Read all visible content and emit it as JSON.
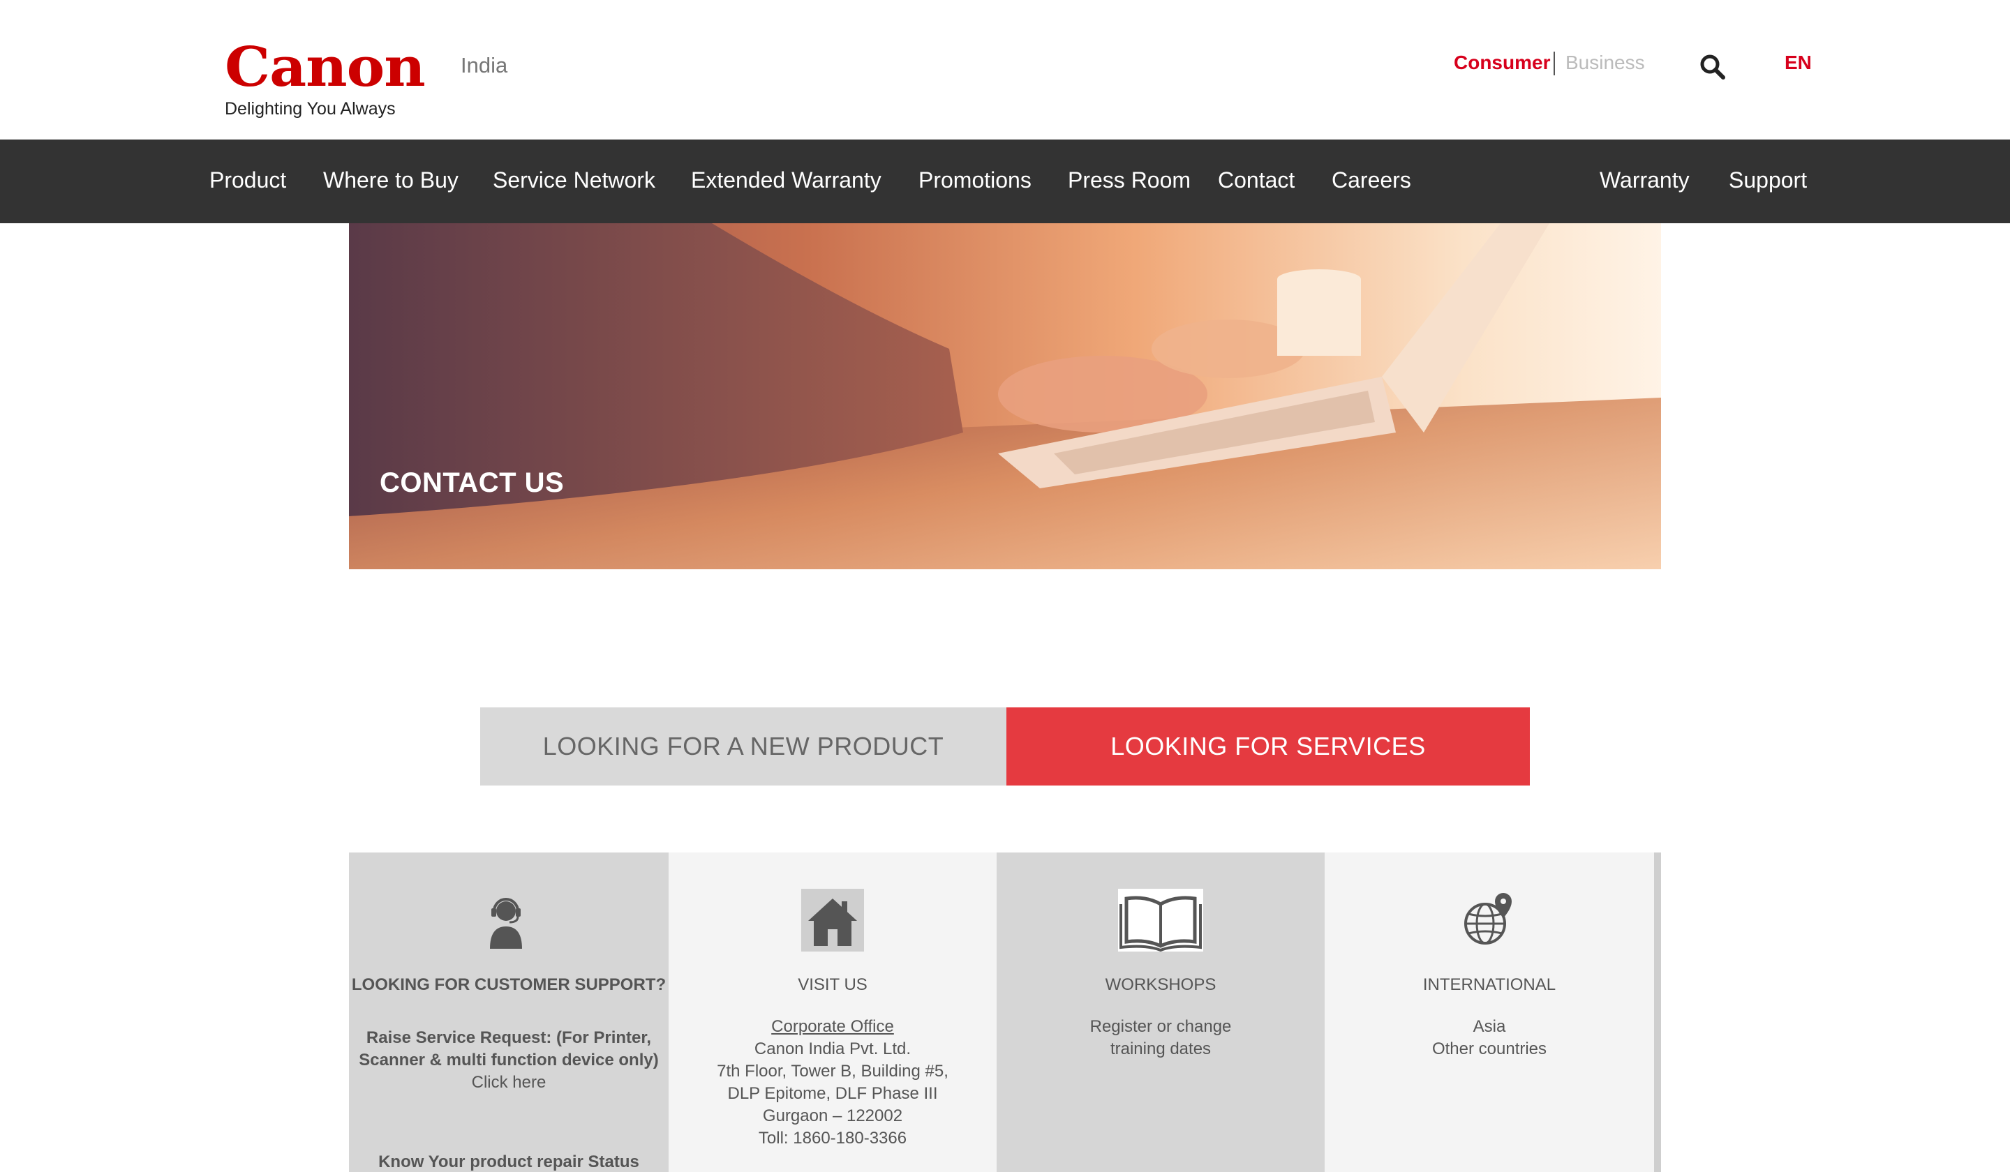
{
  "header": {
    "brand": "Canon",
    "tagline": "Delighting You Always",
    "region": "India",
    "segment_consumer": "Consumer",
    "segment_business": "Business",
    "language": "EN"
  },
  "nav": {
    "items": [
      "Product",
      "Where to Buy",
      "Service Network",
      "Extended Warranty",
      "Promotions",
      "Press Room",
      "Contact",
      "Careers"
    ],
    "right_items": [
      "Warranty",
      "Support"
    ]
  },
  "hero": {
    "title": "CONTACT US"
  },
  "tabs": {
    "new_product": "LOOKING FOR A NEW PRODUCT",
    "services": "LOOKING FOR SERVICES"
  },
  "cards": {
    "support": {
      "icon": "headset-user-icon",
      "title": "LOOKING FOR CUSTOMER SUPPORT?",
      "line1": "Raise Service Request: (For Printer,",
      "line2": "Scanner & multi function device only)",
      "link": "Click here",
      "status": "Know Your product repair Status"
    },
    "visit": {
      "icon": "home-icon",
      "title": "VISIT US",
      "link": "Corporate Office",
      "lines": [
        "Canon India Pvt. Ltd.",
        "7th Floor, Tower B, Building #5,",
        "DLP Epitome, DLF Phase III",
        "Gurgaon – 122002",
        "Toll: 1860-180-3366"
      ]
    },
    "workshops": {
      "icon": "open-book-icon",
      "title": "WORKSHOPS",
      "lines": [
        "Register or change",
        "training dates"
      ]
    },
    "international": {
      "icon": "globe-pin-icon",
      "title": "INTERNATIONAL",
      "links": [
        "Asia",
        "Other countries"
      ]
    }
  },
  "colors": {
    "brand_red": "#cc0000",
    "accent_red": "#e53a40",
    "nav_bg": "#333333"
  }
}
